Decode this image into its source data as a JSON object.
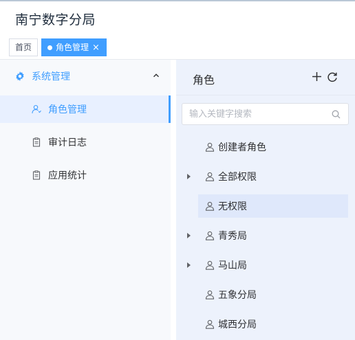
{
  "app": {
    "title": "南宁数字分局"
  },
  "tabs": [
    {
      "label": "首页"
    },
    {
      "label": "角色管理",
      "close": "×"
    }
  ],
  "sidebar": {
    "group": {
      "label": "系统管理",
      "icon": "gear-icon",
      "expanded": true
    },
    "items": [
      {
        "label": "角色管理",
        "icon": "role-icon",
        "active": true
      },
      {
        "label": "审计日志",
        "icon": "document-icon"
      },
      {
        "label": "应用统计",
        "icon": "document-icon"
      }
    ]
  },
  "panel": {
    "title": "角色",
    "search_placeholder": "输入关键字搜索",
    "tree": [
      {
        "label": "创建者角色",
        "expandable": false
      },
      {
        "label": "全部权限",
        "expandable": true
      },
      {
        "label": "无权限",
        "expandable": false,
        "selected": true
      },
      {
        "label": "青秀局",
        "expandable": true
      },
      {
        "label": "马山局",
        "expandable": true
      },
      {
        "label": "五象分局",
        "expandable": false
      },
      {
        "label": "城西分局",
        "expandable": false
      }
    ]
  },
  "colors": {
    "accent": "#409eff",
    "panel_bg": "#edf2fc",
    "sidebar_bg": "#f7f9fc"
  }
}
